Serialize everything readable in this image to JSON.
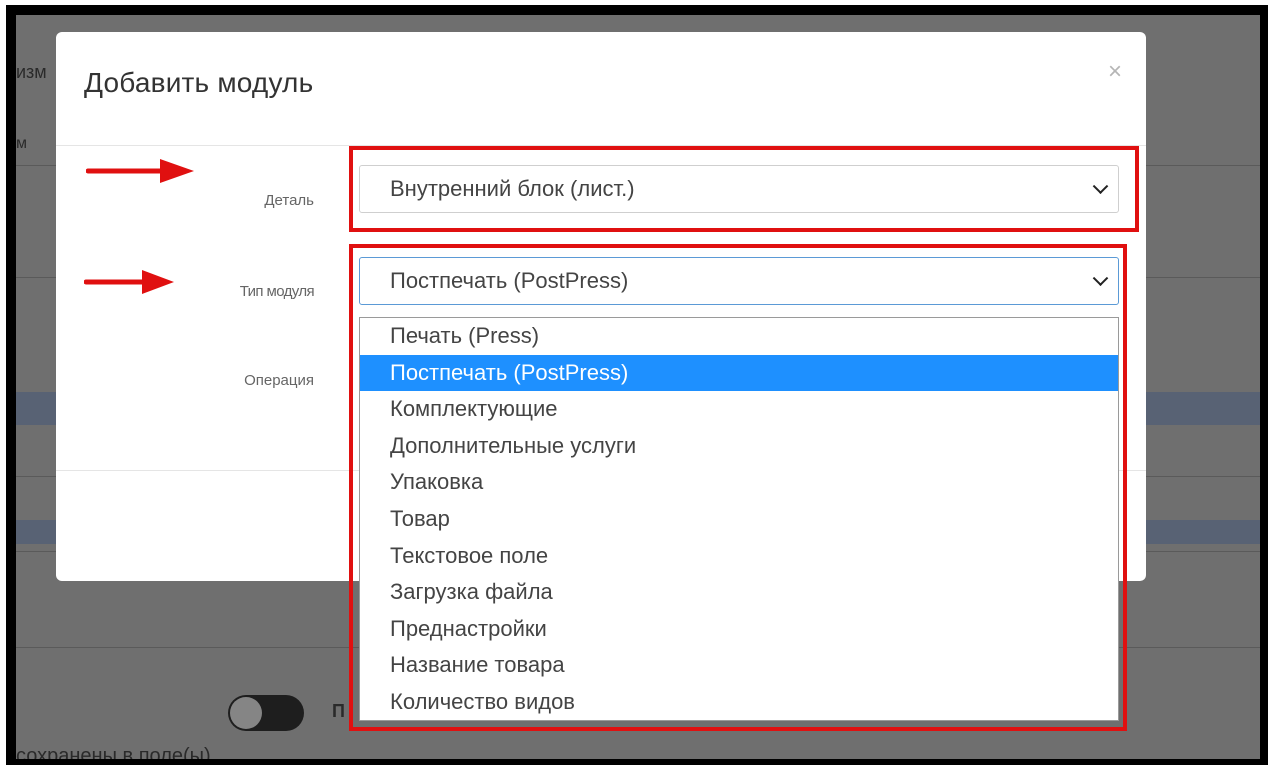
{
  "background": {
    "left_text_1": "изм",
    "left_text_2": "м",
    "toggle_label": "П",
    "bottom_text": "сохранены в поле(ы)"
  },
  "modal": {
    "title": "Добавить модуль",
    "close_symbol": "×",
    "fields": {
      "detail": {
        "label": "Деталь",
        "value": "Внутренний блок (лист.)"
      },
      "module_type": {
        "label": "Тип модуля",
        "value": "Постпечать (PostPress)"
      },
      "operation": {
        "label": "Операция"
      }
    },
    "dropdown_options": [
      "Печать (Press)",
      "Постпечать (PostPress)",
      "Комплектующие",
      "Дополнительные услуги",
      "Упаковка",
      "Товар",
      "Текстовое поле",
      "Загрузка файла",
      "Преднастройки",
      "Название товара",
      "Количество видов"
    ],
    "selected_option_index": 1
  },
  "colors": {
    "highlight": "#e01010",
    "selected_option_bg": "#1e90ff",
    "overlay": "#6f6f6f"
  }
}
